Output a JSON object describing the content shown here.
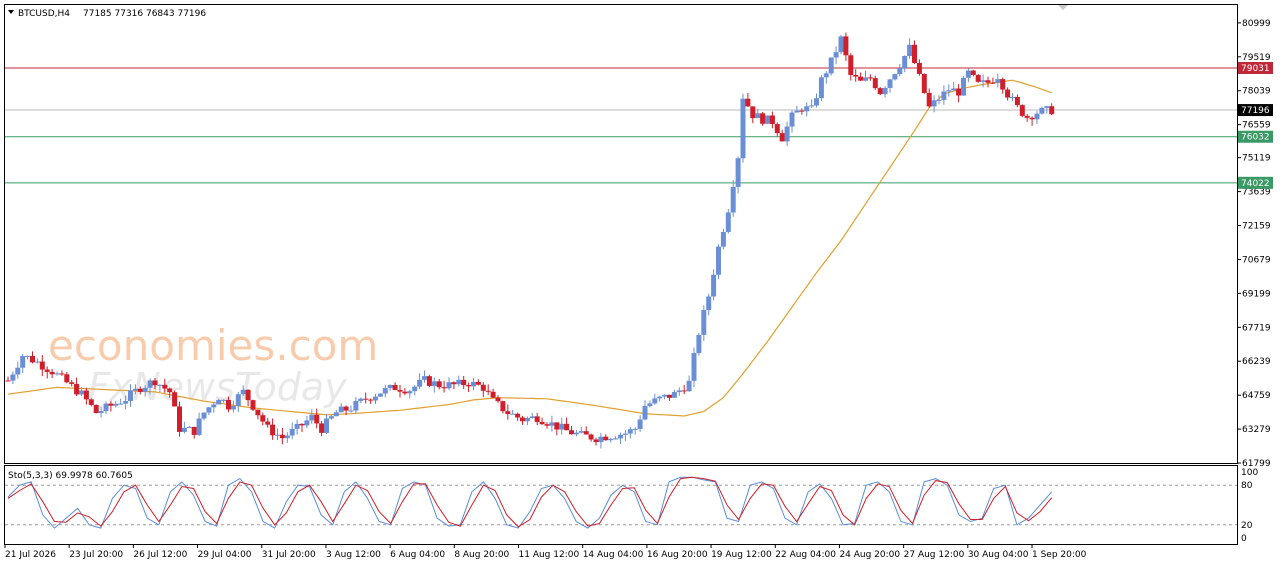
{
  "header": {
    "symbol_label": "BTCUSD,H4",
    "ohlc_label": "77185 77316 76843 77196"
  },
  "watermark": {
    "line1": "economies.com",
    "line2": "FxNewsToday"
  },
  "colors": {
    "bull": "#6b8fd6",
    "bear": "#d01f2a",
    "ma": "#e0a030",
    "resistance": "#c0283a",
    "support": "#3a9a66",
    "current": "#bbbbbb",
    "stoch_main": "#5a8fd8",
    "stoch_signal": "#d01f2a"
  },
  "chart_data": [
    {
      "type": "candlestick",
      "name": "price",
      "ylim": [
        61799,
        81779
      ],
      "y_ticks": [
        80999,
        79519,
        78039,
        76559,
        75119,
        73639,
        72159,
        70679,
        69199,
        67719,
        66239,
        64759,
        63279,
        61799
      ],
      "x_labels": [
        "21 Jul 2026",
        "23 Jul 20:00",
        "26 Jul 12:00",
        "29 Jul 04:00",
        "31 Jul 20:00",
        "3 Aug 12:00",
        "6 Aug 04:00",
        "8 Aug 20:00",
        "11 Aug 12:00",
        "14 Aug 04:00",
        "16 Aug 20:00",
        "19 Aug 12:00",
        "22 Aug 04:00",
        "24 Aug 20:00",
        "27 Aug 12:00",
        "30 Aug 04:00",
        "1 Sep 20:00"
      ],
      "levels": [
        {
          "label": "79031",
          "value": 79031,
          "kind": "resistance"
        },
        {
          "label": "77196",
          "value": 77196,
          "kind": "current"
        },
        {
          "label": "76032",
          "value": 76032,
          "kind": "support"
        },
        {
          "label": "74022",
          "value": 74022,
          "kind": "support"
        }
      ],
      "close_path": [
        [
          0,
          65400
        ],
        [
          3,
          66500
        ],
        [
          6,
          66200
        ],
        [
          9,
          65800
        ],
        [
          12,
          65300
        ],
        [
          15,
          64800
        ],
        [
          18,
          64000
        ],
        [
          21,
          64300
        ],
        [
          24,
          64600
        ],
        [
          27,
          65100
        ],
        [
          30,
          65400
        ],
        [
          33,
          64900
        ],
        [
          35,
          63300
        ],
        [
          38,
          63200
        ],
        [
          40,
          64000
        ],
        [
          43,
          64700
        ],
        [
          45,
          64300
        ],
        [
          48,
          64900
        ],
        [
          50,
          64300
        ],
        [
          53,
          63300
        ],
        [
          56,
          62900
        ],
        [
          59,
          63300
        ],
        [
          62,
          63800
        ],
        [
          64,
          63300
        ],
        [
          67,
          64000
        ],
        [
          70,
          64200
        ],
        [
          73,
          64600
        ],
        [
          76,
          64900
        ],
        [
          79,
          65100
        ],
        [
          82,
          65000
        ],
        [
          85,
          65400
        ],
        [
          88,
          65200
        ],
        [
          91,
          65200
        ],
        [
          94,
          65300
        ],
        [
          97,
          65100
        ],
        [
          99,
          64500
        ],
        [
          102,
          64000
        ],
        [
          105,
          63700
        ],
        [
          108,
          63800
        ],
        [
          111,
          63500
        ],
        [
          114,
          63200
        ],
        [
          117,
          63000
        ],
        [
          120,
          62900
        ],
        [
          123,
          63000
        ],
        [
          126,
          63100
        ],
        [
          128,
          63300
        ],
        [
          130,
          64300
        ],
        [
          133,
          64600
        ],
        [
          136,
          64800
        ],
        [
          139,
          65300
        ],
        [
          141,
          67500
        ],
        [
          143,
          69100
        ],
        [
          145,
          71200
        ],
        [
          147,
          72900
        ],
        [
          149,
          75200
        ],
        [
          150,
          77800
        ],
        [
          152,
          77000
        ],
        [
          154,
          76800
        ],
        [
          156,
          76700
        ],
        [
          158,
          76000
        ],
        [
          160,
          76900
        ],
        [
          162,
          77300
        ],
        [
          164,
          77200
        ],
        [
          166,
          78500
        ],
        [
          168,
          79300
        ],
        [
          170,
          80300
        ],
        [
          172,
          78700
        ],
        [
          174,
          78400
        ],
        [
          176,
          78600
        ],
        [
          178,
          78000
        ],
        [
          180,
          78600
        ],
        [
          182,
          79200
        ],
        [
          184,
          79900
        ],
        [
          186,
          78600
        ],
        [
          188,
          77300
        ],
        [
          190,
          77700
        ],
        [
          192,
          78100
        ],
        [
          194,
          78000
        ],
        [
          196,
          78800
        ],
        [
          198,
          78300
        ],
        [
          200,
          78400
        ],
        [
          202,
          78700
        ],
        [
          204,
          77900
        ],
        [
          206,
          77300
        ],
        [
          208,
          76900
        ],
        [
          210,
          77100
        ],
        [
          213,
          77196
        ]
      ],
      "ma_path": [
        [
          0,
          64800
        ],
        [
          10,
          65100
        ],
        [
          20,
          65000
        ],
        [
          30,
          64900
        ],
        [
          40,
          64500
        ],
        [
          50,
          64200
        ],
        [
          60,
          64000
        ],
        [
          65,
          63900
        ],
        [
          70,
          63950
        ],
        [
          80,
          64100
        ],
        [
          90,
          64350
        ],
        [
          95,
          64550
        ],
        [
          100,
          64650
        ],
        [
          110,
          64600
        ],
        [
          120,
          64300
        ],
        [
          130,
          63950
        ],
        [
          138,
          63850
        ],
        [
          142,
          64050
        ],
        [
          146,
          64650
        ],
        [
          150,
          65700
        ],
        [
          155,
          67100
        ],
        [
          160,
          68600
        ],
        [
          165,
          70100
        ],
        [
          170,
          71500
        ],
        [
          175,
          73100
        ],
        [
          180,
          74700
        ],
        [
          185,
          76300
        ],
        [
          188,
          77300
        ],
        [
          191,
          77900
        ],
        [
          195,
          78150
        ],
        [
          200,
          78350
        ],
        [
          205,
          78500
        ],
        [
          209,
          78250
        ],
        [
          213,
          77950
        ]
      ]
    },
    {
      "type": "line",
      "name": "stochastic",
      "label": "Sto(5,3,3) 69.9978 60.7605",
      "ylim": [
        0,
        100
      ],
      "y_ticks": [
        100,
        80,
        20,
        0
      ],
      "levels": [
        80,
        20
      ],
      "series": [
        {
          "name": "main",
          "values": [
            62,
            80,
            85,
            35,
            15,
            30,
            45,
            20,
            15,
            60,
            80,
            75,
            30,
            20,
            70,
            85,
            65,
            25,
            18,
            80,
            90,
            70,
            25,
            15,
            55,
            80,
            78,
            35,
            20,
            70,
            85,
            60,
            25,
            20,
            75,
            85,
            80,
            30,
            18,
            20,
            70,
            85,
            60,
            20,
            15,
            40,
            75,
            80,
            60,
            25,
            15,
            30,
            65,
            80,
            70,
            25,
            20,
            85,
            92,
            92,
            88,
            85,
            30,
            25,
            80,
            85,
            75,
            30,
            20,
            70,
            82,
            60,
            20,
            22,
            80,
            85,
            70,
            25,
            20,
            85,
            90,
            80,
            35,
            25,
            30,
            75,
            80,
            20,
            30,
            50,
            70
          ]
        },
        {
          "name": "signal",
          "values": [
            60,
            72,
            82,
            55,
            25,
            24,
            38,
            32,
            18,
            40,
            70,
            80,
            50,
            25,
            50,
            78,
            75,
            40,
            22,
            60,
            85,
            80,
            45,
            20,
            38,
            70,
            80,
            55,
            25,
            52,
            80,
            72,
            40,
            22,
            55,
            82,
            82,
            50,
            24,
            18,
            50,
            80,
            72,
            35,
            17,
            28,
            62,
            80,
            70,
            40,
            18,
            22,
            50,
            75,
            76,
            42,
            22,
            62,
            90,
            92,
            90,
            86,
            50,
            28,
            60,
            82,
            80,
            48,
            25,
            52,
            78,
            72,
            35,
            20,
            60,
            82,
            78,
            42,
            22,
            65,
            87,
            84,
            52,
            28,
            28,
            60,
            78,
            38,
            26,
            40,
            61
          ]
        }
      ]
    }
  ]
}
